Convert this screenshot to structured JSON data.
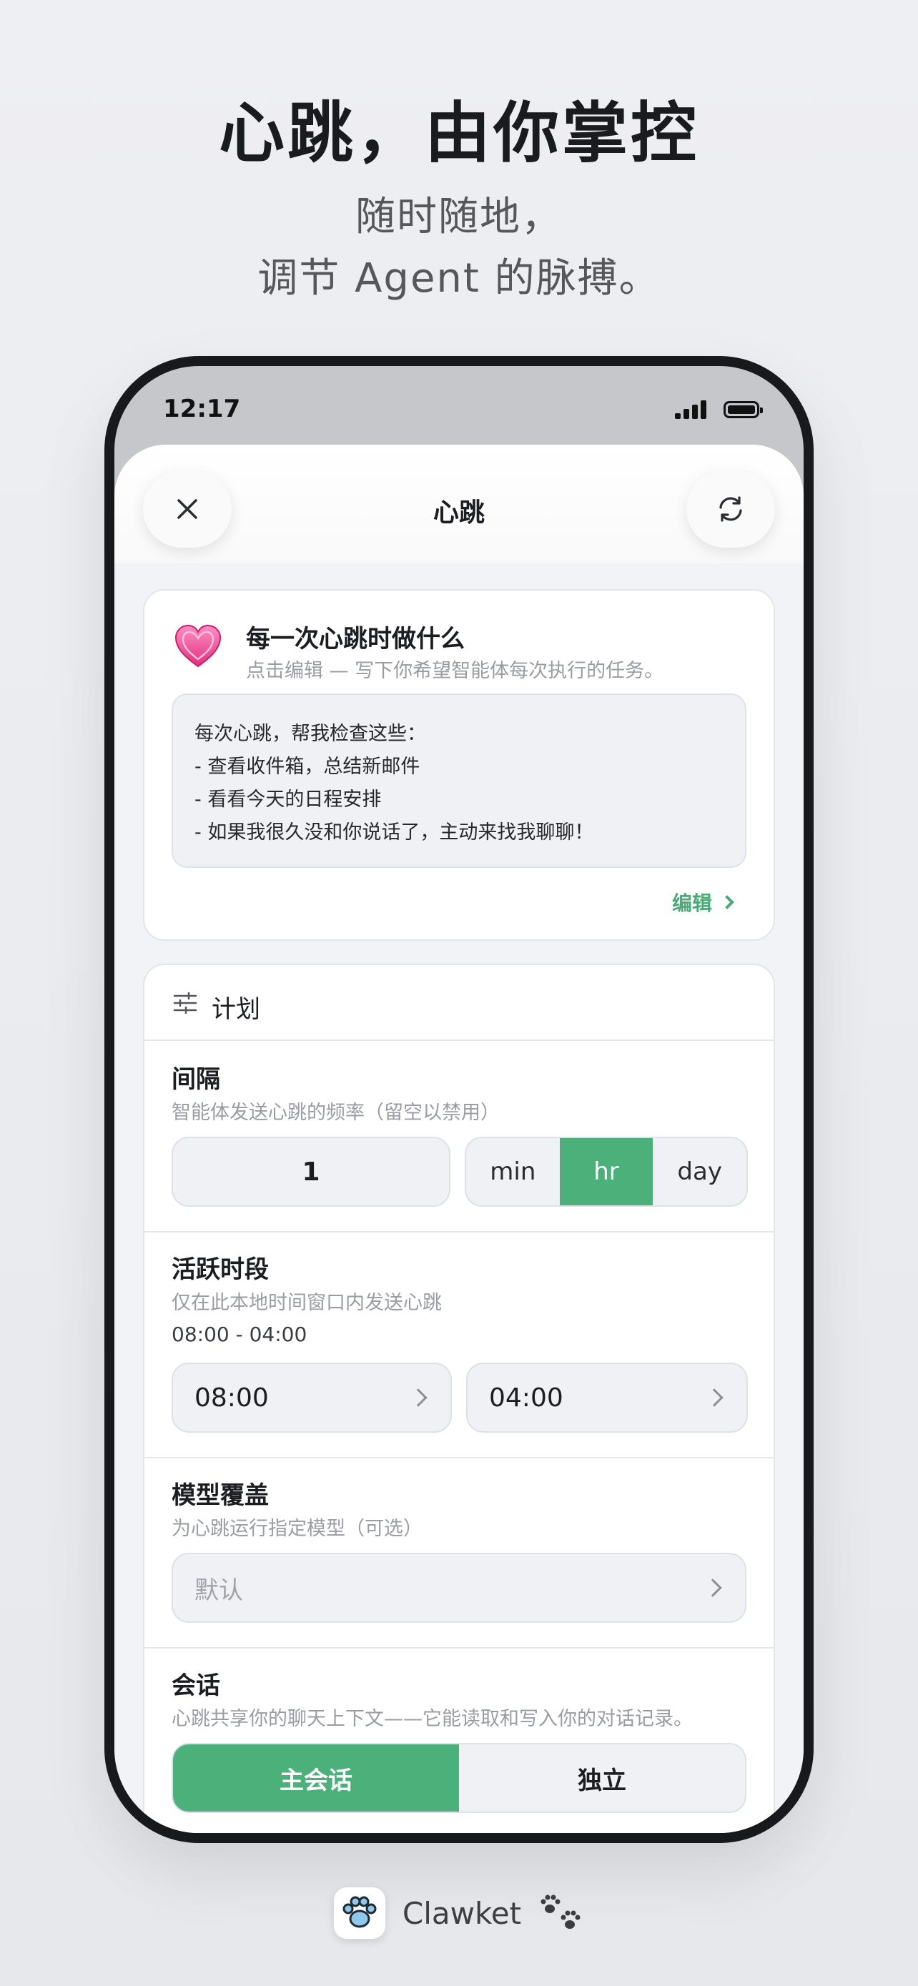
{
  "marketing": {
    "headline": "心跳，由你掌控",
    "subline1": "随时随地，",
    "subline2": "调节 Agent 的脉搏。"
  },
  "status_bar": {
    "time": "12:17"
  },
  "sheet": {
    "title": "心跳",
    "close_icon": "close-icon",
    "refresh_icon": "refresh-icon"
  },
  "task_card": {
    "icon": "pink-heart-icon",
    "title": "每一次心跳时做什么",
    "subtitle": "点击编辑 — 写下你希望智能体每次执行的任务。",
    "lines": [
      "每次心跳，帮我检查这些：",
      "- 查看收件箱，总结新邮件",
      "- 看看今天的日程安排",
      "- 如果我很久没和你说话了，主动来找我聊聊！"
    ],
    "edit_label": "编辑"
  },
  "plan": {
    "title": "计划",
    "interval": {
      "label": "间隔",
      "hint": "智能体发送心跳的频率（留空以禁用）",
      "value": "1",
      "units": [
        "min",
        "hr",
        "day"
      ],
      "selected_unit": "hr"
    },
    "active_hours": {
      "label": "活跃时段",
      "hint": "仅在此本地时间窗口内发送心跳",
      "range": "08:00 - 04:00",
      "start": "08:00",
      "end": "04:00"
    },
    "model": {
      "label": "模型覆盖",
      "hint": "为心跳运行指定模型（可选）",
      "placeholder": "默认"
    },
    "session": {
      "label": "会话",
      "hint": "心跳共享你的聊天上下文——它能读取和写入你的对话记录。",
      "options": [
        "主会话",
        "独立"
      ],
      "selected": "主会话"
    }
  },
  "footer": {
    "app_name": "Clawket",
    "app_icon": "paw-app-icon",
    "paw_icon": "paw-prints-icon"
  },
  "colors": {
    "accent_green": "#4cb07b",
    "background": "#eeeff2"
  }
}
